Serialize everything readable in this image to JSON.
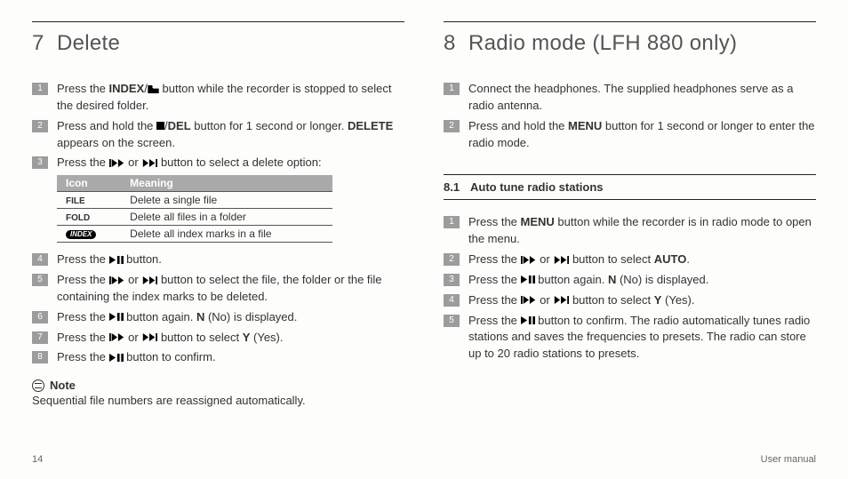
{
  "footer": {
    "pagenum": "14",
    "label": "User manual"
  },
  "chart_data": {
    "type": "table",
    "title": "Delete option icons",
    "columns": [
      "Icon",
      "Meaning"
    ],
    "rows": [
      [
        "FILE",
        "Delete a single file"
      ],
      [
        "FOLD",
        "Delete all files in a folder"
      ],
      [
        "INDEX",
        "Delete all index marks in a file"
      ]
    ]
  },
  "left": {
    "num": "7",
    "title": "Delete",
    "steps_a": [
      {
        "n": "1",
        "parts": [
          "Press the ",
          {
            "b": "INDEX"
          },
          "/",
          {
            "ic": "folder"
          },
          " button while the recorder is stopped to select the desired folder."
        ]
      },
      {
        "n": "2",
        "parts": [
          "Press and hold the ",
          {
            "ic": "stop"
          },
          "/",
          {
            "b": "DEL"
          },
          " button for 1 second or longer. ",
          {
            "b": "DELETE"
          },
          " appears on the screen."
        ]
      },
      {
        "n": "3",
        "parts": [
          "Press the ",
          {
            "ic": "prev"
          },
          " or ",
          {
            "ic": "next"
          },
          " button to select a delete option:"
        ]
      }
    ],
    "table": {
      "head": [
        "Icon",
        "Meaning"
      ],
      "rows": [
        {
          "icon_kind": "text",
          "icon": "FILE",
          "meaning": "Delete a single file"
        },
        {
          "icon_kind": "text",
          "icon": "FOLD",
          "meaning": "Delete all files in a folder"
        },
        {
          "icon_kind": "pill",
          "icon": "INDEX",
          "meaning": "Delete all index marks in a file"
        }
      ]
    },
    "steps_b": [
      {
        "n": "4",
        "parts": [
          "Press the ",
          {
            "ic": "playpause"
          },
          " button."
        ]
      },
      {
        "n": "5",
        "parts": [
          "Press the ",
          {
            "ic": "prev"
          },
          " or ",
          {
            "ic": "next"
          },
          " button to select the file, the folder or the file containing the index marks to be deleted."
        ]
      },
      {
        "n": "6",
        "parts": [
          "Press the ",
          {
            "ic": "playpause"
          },
          " button again. ",
          {
            "b": "N"
          },
          " (No) is displayed."
        ]
      },
      {
        "n": "7",
        "parts": [
          "Press the ",
          {
            "ic": "prev"
          },
          " or ",
          {
            "ic": "next"
          },
          " button to select ",
          {
            "b": "Y"
          },
          " (Yes)."
        ]
      },
      {
        "n": "8",
        "parts": [
          "Press the ",
          {
            "ic": "playpause"
          },
          " button to confirm."
        ]
      }
    ],
    "note_label": "Note",
    "note_text": "Sequential file numbers are reassigned automatically."
  },
  "right": {
    "num": "8",
    "title": "Radio mode (LFH 880 only)",
    "steps_intro": [
      {
        "n": "1",
        "parts": [
          "Connect the headphones. The supplied headphones serve as a radio antenna."
        ]
      },
      {
        "n": "2",
        "parts": [
          "Press and hold the ",
          {
            "b": "MENU"
          },
          " button for 1 second or longer to enter the radio mode."
        ]
      }
    ],
    "sub_num": "8.1",
    "sub_title": "Auto tune radio stations",
    "steps_sub": [
      {
        "n": "1",
        "parts": [
          "Press the ",
          {
            "b": "MENU"
          },
          " button while the recorder is in radio mode to open the menu."
        ]
      },
      {
        "n": "2",
        "parts": [
          "Press the ",
          {
            "ic": "prev"
          },
          " or ",
          {
            "ic": "next"
          },
          " button to select ",
          {
            "b": "AUTO"
          },
          "."
        ]
      },
      {
        "n": "3",
        "parts": [
          "Press the ",
          {
            "ic": "playpause"
          },
          " button again. ",
          {
            "b": "N"
          },
          " (No) is displayed."
        ]
      },
      {
        "n": "4",
        "parts": [
          "Press the ",
          {
            "ic": "prev"
          },
          " or ",
          {
            "ic": "next"
          },
          " button to select ",
          {
            "b": "Y"
          },
          " (Yes)."
        ]
      },
      {
        "n": "5",
        "parts": [
          "Press the ",
          {
            "ic": "playpause"
          },
          " button to confirm. The radio automatically tunes radio stations and saves the frequencies to presets. The radio can store up to 20 radio stations to presets."
        ]
      }
    ]
  }
}
